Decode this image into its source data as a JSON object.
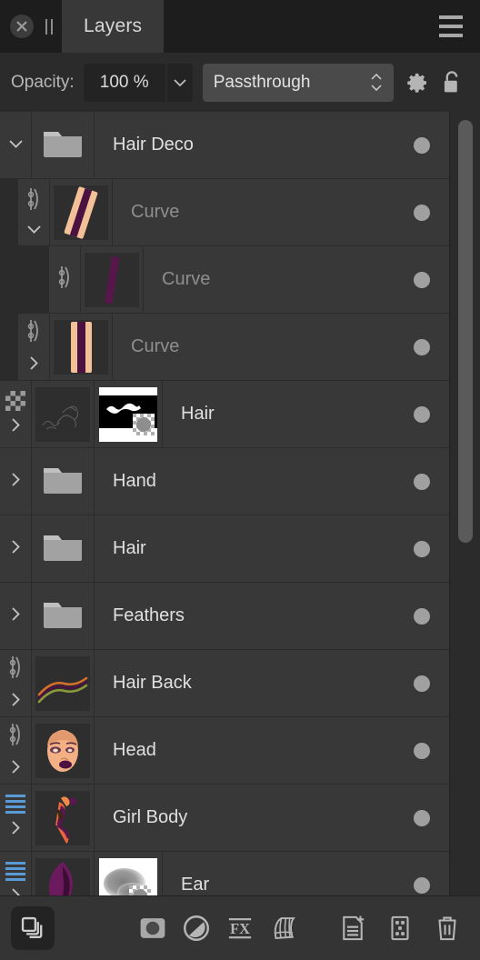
{
  "window": {
    "title": "Layers",
    "close_icon": "close-circle-icon",
    "pause_icon": "pause-icon",
    "menu_icon": "hamburger-menu-icon"
  },
  "options_bar": {
    "opacity_label": "Opacity:",
    "opacity_value": "100 %",
    "opacity_dropdown_icon": "chevron-down-icon",
    "blend_mode": "Passthrough",
    "blend_spinner_icon": "spinner-updown-icon",
    "gear_icon": "gear-icon",
    "lock_icon": "unlocked-padlock-icon"
  },
  "colors": {
    "panel_bg": "#2b2b2b",
    "row_bg": "#383838",
    "titlebar_bg": "#1d1d1d",
    "field_bg": "#232323",
    "blend_bg": "#4a4a4a",
    "text": "#e0e0e0",
    "muted_text": "#8e8e8e",
    "visibility_dot": "#a0a0a0",
    "accent_blue": "#5b9bd5",
    "scrollbar_thumb": "#5a5a5a",
    "bottombar_bg": "#343434"
  },
  "layers": [
    {
      "name": "Hair Deco",
      "indent": 0,
      "kind": "group",
      "thumb": "folder",
      "gutter_icon": "chevron-down-icon",
      "expanded": true,
      "clipped": false,
      "muted": false,
      "has_mask": false,
      "visible": true
    },
    {
      "name": "Curve",
      "indent": 1,
      "kind": "shape",
      "thumb": "curve-double-stripe",
      "gutter_icon": "chevron-down-icon",
      "expanded": true,
      "clipped": true,
      "muted": true,
      "has_mask": false,
      "visible": true
    },
    {
      "name": "Curve",
      "indent": 2,
      "kind": "shape",
      "thumb": "curve-single-stripe",
      "gutter_icon": "none",
      "expanded": false,
      "clipped": true,
      "muted": true,
      "has_mask": false,
      "visible": true
    },
    {
      "name": "Curve",
      "indent": 1,
      "kind": "shape",
      "thumb": "curve-vertical-stripe",
      "gutter_icon": "chevron-right-icon",
      "expanded": false,
      "clipped": true,
      "muted": true,
      "has_mask": false,
      "visible": true
    },
    {
      "name": "Hair",
      "indent": 0,
      "kind": "pixel",
      "thumb": "hair-strands",
      "gutter_icon": "chevron-right-icon",
      "expanded": false,
      "clipped": false,
      "muted": false,
      "has_mask": true,
      "mask_style": "hair-mask",
      "transparency_icon": "checkerboard-icon",
      "visible": true
    },
    {
      "name": "Hand",
      "indent": 0,
      "kind": "group",
      "thumb": "folder",
      "gutter_icon": "chevron-right-icon",
      "expanded": false,
      "clipped": false,
      "muted": false,
      "has_mask": false,
      "visible": true
    },
    {
      "name": "Hair",
      "indent": 0,
      "kind": "group",
      "thumb": "folder",
      "gutter_icon": "chevron-right-icon",
      "expanded": false,
      "clipped": false,
      "muted": false,
      "has_mask": false,
      "visible": true
    },
    {
      "name": "Feathers",
      "indent": 0,
      "kind": "group",
      "thumb": "folder",
      "gutter_icon": "chevron-right-icon",
      "expanded": false,
      "clipped": false,
      "muted": false,
      "has_mask": false,
      "visible": true
    },
    {
      "name": "Hair Back",
      "indent": 0,
      "kind": "shape",
      "thumb": "hair-back-wave",
      "gutter_icon": "chevron-right-icon",
      "expanded": false,
      "clipped": true,
      "muted": false,
      "has_mask": false,
      "visible": true
    },
    {
      "name": "Head",
      "indent": 0,
      "kind": "shape",
      "thumb": "head-face",
      "gutter_icon": "chevron-right-icon",
      "expanded": false,
      "clipped": true,
      "muted": false,
      "has_mask": false,
      "visible": true
    },
    {
      "name": "Girl Body",
      "indent": 0,
      "kind": "pixel",
      "thumb": "girl-body",
      "gutter_icon": "chevron-right-icon",
      "expanded": false,
      "clipped": false,
      "muted": false,
      "has_mask": false,
      "stack_icon": "blue-lines-icon",
      "visible": true
    },
    {
      "name": "Ear",
      "indent": 0,
      "kind": "pixel",
      "thumb": "ear-shape",
      "gutter_icon": "chevron-right-icon",
      "expanded": false,
      "clipped": false,
      "muted": false,
      "has_mask": true,
      "mask_style": "ear-mask",
      "stack_icon": "blue-lines-icon",
      "visible": true
    }
  ],
  "scrollbar": {
    "thumb_top_pct": 1,
    "thumb_height_pct": 54
  },
  "bottom_toolbar": {
    "buttons": [
      {
        "name": "layer-stack-button",
        "icon": "layers-stack-icon",
        "active": true
      },
      {
        "name": "add-mask-button",
        "icon": "mask-icon",
        "active": false
      },
      {
        "name": "adjustment-layer-button",
        "icon": "adjustment-circle-icon",
        "active": false
      },
      {
        "name": "layer-effects-button",
        "icon": "fx-icon",
        "active": false
      },
      {
        "name": "mesh-warp-button",
        "icon": "mesh-warp-icon",
        "active": false
      },
      {
        "name": "new-layer-button",
        "icon": "new-document-plus-icon",
        "active": false
      },
      {
        "name": "new-mask-layer-button",
        "icon": "checkerboard-document-icon",
        "active": false
      },
      {
        "name": "delete-layer-button",
        "icon": "trash-icon",
        "active": false
      }
    ]
  }
}
